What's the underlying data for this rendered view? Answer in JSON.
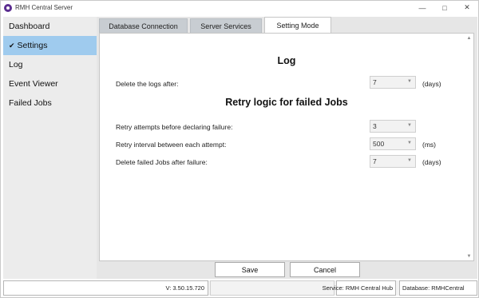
{
  "window": {
    "title": "RMH Central Server"
  },
  "sidebar": {
    "items": [
      {
        "label": "Dashboard",
        "active": false
      },
      {
        "label": "Settings",
        "active": true
      },
      {
        "label": "Log",
        "active": false
      },
      {
        "label": "Event Viewer",
        "active": false
      },
      {
        "label": "Failed Jobs",
        "active": false
      }
    ]
  },
  "tabs": [
    {
      "label": "Database Connection",
      "active": false
    },
    {
      "label": "Server Services",
      "active": false
    },
    {
      "label": "Setting Mode",
      "active": true
    }
  ],
  "log_section": {
    "title": "Log",
    "delete_logs": {
      "label": "Delete the logs after:",
      "value": "7",
      "unit": "(days)"
    }
  },
  "retry_section": {
    "title": "Retry logic for failed Jobs",
    "attempts": {
      "label": "Retry attempts before declaring failure:",
      "value": "3"
    },
    "interval": {
      "label": "Retry interval between each attempt:",
      "value": "500",
      "unit": "(ms)"
    },
    "delete_failed": {
      "label": "Delete failed Jobs after failure:",
      "value": "7",
      "unit": "(days)"
    }
  },
  "buttons": {
    "save": "Save",
    "cancel": "Cancel"
  },
  "statusbar": {
    "version": "V: 3.50.15.720",
    "service": "Service: RMH Central Hub",
    "service_status_color": "#d51b1b",
    "database": "Database: RMHCentral"
  },
  "colors": {
    "sidebar_active": "#9fcbee",
    "sidebar_bg": "#ececec",
    "tab_inactive": "#c8cdd2"
  }
}
